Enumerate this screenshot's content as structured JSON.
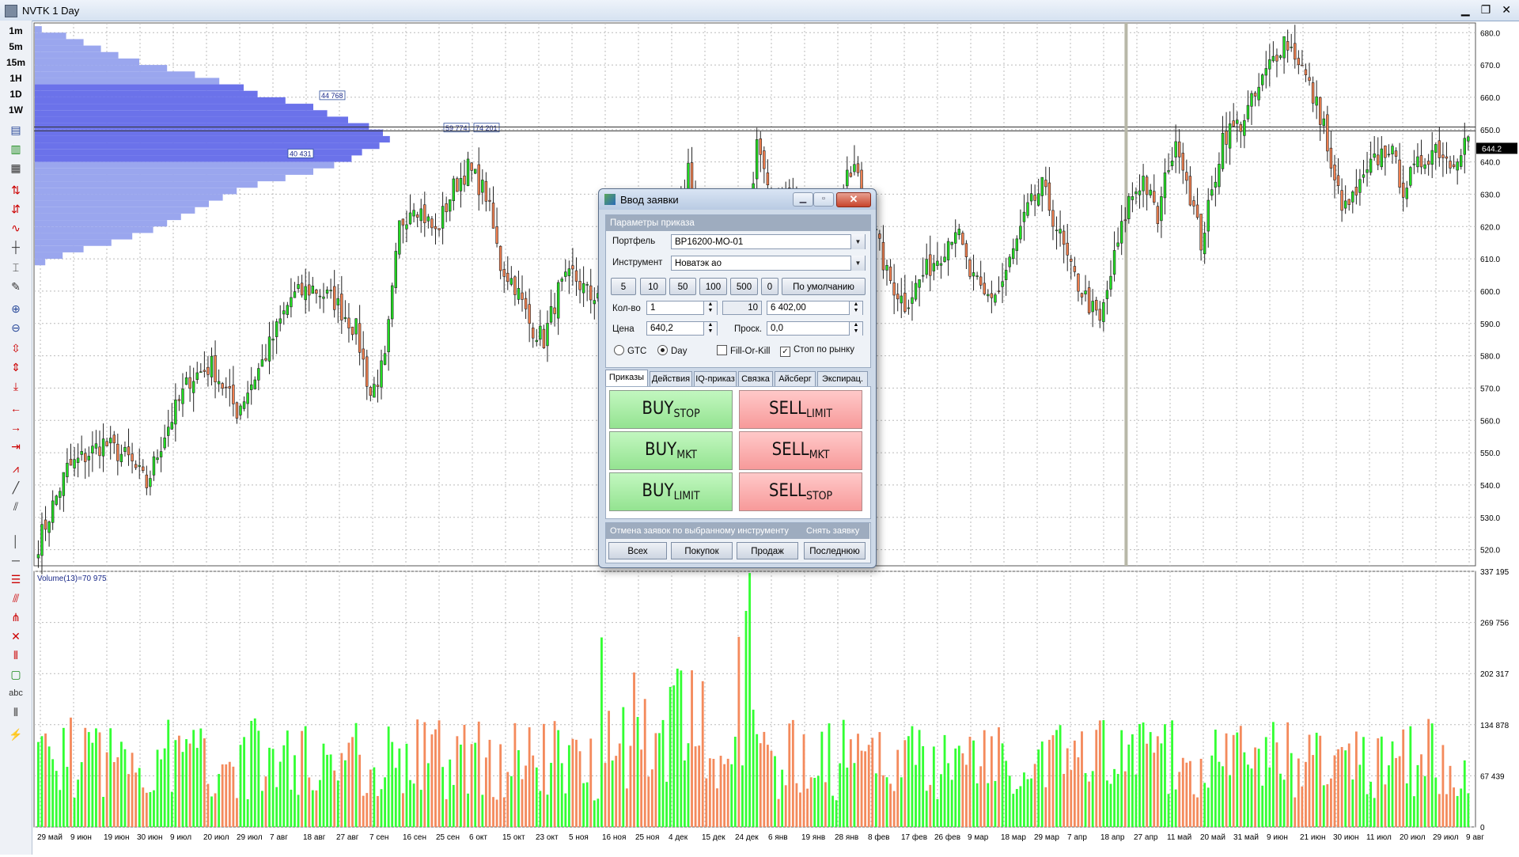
{
  "window": {
    "title": "NVTK 1 Day",
    "controls": [
      "▁",
      "❐",
      "✕"
    ]
  },
  "timeframes": [
    "1m",
    "5m",
    "15m",
    "1H",
    "1D",
    "1W"
  ],
  "toolbar_icons": [
    "line-chart-icon",
    "candle-icon",
    "bar-icon",
    "trend-up-icon",
    "trend-down-icon",
    "wave-icon",
    "crosshair-icon",
    "cursor-icon",
    "pen-icon",
    "zoom-in-icon",
    "zoom-out-icon",
    "fit-icon",
    "arrow-left-icon",
    "arrow-right-icon",
    "arrow-end-icon",
    "line-tool-icon",
    "channel-icon",
    "fib-icon",
    "text-icon",
    "rectangle-icon"
  ],
  "chart_data": [
    {
      "type": "candlestick",
      "instrument": "NVTK",
      "interval": "1 Day",
      "y_ticks": [
        "680.0",
        "670.0",
        "660.0",
        "650.0",
        "640.0",
        "630.0",
        "620.0",
        "610.0",
        "600.0",
        "590.0",
        "580.0",
        "570.0",
        "560.0",
        "550.0",
        "540.0",
        "530.0",
        "520.0"
      ],
      "ylim": [
        515,
        683
      ],
      "last_price": "644.2",
      "x_ticks": [
        "29 май",
        "9 июн",
        "19 июн",
        "30 июн",
        "9 июл",
        "20 июл",
        "29 июл",
        "7 авг",
        "18 авг",
        "27 авг",
        "7 сен",
        "16 сен",
        "25 сен",
        "6 окт",
        "15 окт",
        "23 окт",
        "5 ноя",
        "16 ноя",
        "25 ноя",
        "4 дек",
        "15 дек",
        "24 дек",
        "6 янв",
        "19 янв",
        "28 янв",
        "8 фев",
        "17 фев",
        "26 фев",
        "9 мар",
        "18 мар",
        "29 мар",
        "7 апр",
        "18 апр",
        "27 апр",
        "11 май",
        "20 май",
        "31 май",
        "9 июн",
        "21 июн",
        "30 июн",
        "11 июл",
        "20 июл",
        "29 июл",
        "9 авг"
      ],
      "profile_labels": [
        "44 768",
        "59 774",
        "74 201",
        "40 431"
      ],
      "waypoints": [
        [
          0,
          522
        ],
        [
          8,
          545
        ],
        [
          18,
          553
        ],
        [
          25,
          548
        ],
        [
          30,
          540
        ],
        [
          35,
          556
        ],
        [
          42,
          573
        ],
        [
          48,
          577
        ],
        [
          55,
          563
        ],
        [
          62,
          578
        ],
        [
          70,
          598
        ],
        [
          76,
          601
        ],
        [
          82,
          597
        ],
        [
          88,
          588
        ],
        [
          92,
          568
        ],
        [
          96,
          578
        ],
        [
          100,
          620
        ],
        [
          104,
          628
        ],
        [
          110,
          618
        ],
        [
          115,
          632
        ],
        [
          119,
          638
        ],
        [
          124,
          630
        ],
        [
          128,
          608
        ],
        [
          132,
          602
        ],
        [
          136,
          590
        ],
        [
          140,
          585
        ],
        [
          144,
          600
        ],
        [
          148,
          605
        ],
        [
          153,
          598
        ],
        [
          157,
          602
        ],
        [
          162,
          595
        ],
        [
          167,
          590
        ],
        [
          170,
          578
        ],
        [
          173,
          590
        ],
        [
          176,
          615
        ],
        [
          180,
          640
        ],
        [
          183,
          620
        ],
        [
          187,
          605
        ],
        [
          191,
          595
        ],
        [
          195,
          610
        ],
        [
          199,
          645
        ],
        [
          203,
          625
        ],
        [
          207,
          630
        ],
        [
          211,
          622
        ],
        [
          214,
          605
        ],
        [
          218,
          618
        ],
        [
          222,
          630
        ],
        [
          226,
          638
        ],
        [
          230,
          625
        ],
        [
          235,
          605
        ],
        [
          240,
          596
        ],
        [
          245,
          605
        ],
        [
          250,
          612
        ],
        [
          254,
          620
        ],
        [
          258,
          605
        ],
        [
          262,
          598
        ],
        [
          266,
          600
        ],
        [
          270,
          612
        ],
        [
          274,
          625
        ],
        [
          278,
          632
        ],
        [
          282,
          620
        ],
        [
          286,
          606
        ],
        [
          290,
          598
        ],
        [
          294,
          590
        ],
        [
          298,
          610
        ],
        [
          302,
          628
        ],
        [
          306,
          635
        ],
        [
          310,
          622
        ],
        [
          313,
          640
        ],
        [
          316,
          645
        ],
        [
          319,
          630
        ],
        [
          322,
          615
        ],
        [
          325,
          630
        ],
        [
          328,
          648
        ],
        [
          333,
          652
        ],
        [
          337,
          660
        ],
        [
          341,
          670
        ],
        [
          345,
          678
        ],
        [
          349,
          672
        ],
        [
          353,
          660
        ],
        [
          356,
          652
        ],
        [
          358,
          636
        ],
        [
          362,
          625
        ],
        [
          366,
          632
        ],
        [
          370,
          640
        ],
        [
          374,
          645
        ],
        [
          378,
          632
        ],
        [
          383,
          640
        ],
        [
          387,
          645
        ],
        [
          391,
          640
        ],
        [
          396,
          648
        ]
      ],
      "volume": {
        "label": "Volume(13)=70 975",
        "y_ticks": [
          "337 195",
          "269 756",
          "202 317",
          "134 878",
          "67 439",
          "0"
        ],
        "ylim": [
          0,
          337195
        ]
      }
    }
  ],
  "dialog": {
    "title": "Ввод заявки",
    "section_params": "Параметры приказа",
    "portfolio_label": "Портфель",
    "portfolio_value": "BP16200-MO-01",
    "instrument_label": "Инструмент",
    "instrument_value": "Новатэк ао",
    "quick_qty": [
      "5",
      "10",
      "50",
      "100",
      "500",
      "0"
    ],
    "default_button": "По умолчанию",
    "qty_label": "Кол-во",
    "qty_value": "1",
    "lot_value": "10",
    "sum_value": "6 402,00",
    "price_label": "Цена",
    "price_value": "640,2",
    "slippage_label": "Проск.",
    "slippage_value": "0,0",
    "gtc_label": "GTC",
    "day_label": "Day",
    "fok_label": "Fill-Or-Kill",
    "market_stop_label": "Стоп по рынку",
    "tabs": [
      "Приказы",
      "Действия",
      "IQ-приказ",
      "Связка",
      "Айсберг",
      "Экспирац."
    ],
    "orders": {
      "buy": "BUY",
      "sell": "SELL",
      "stop": "STOP",
      "mkt": "MKT",
      "limit": "LIMIT"
    },
    "cancel_section": "Отмена заявок по выбранному инструменту",
    "remove_section": "Снять заявку",
    "cancel_all": "Всех",
    "cancel_buys": "Покупок",
    "cancel_sells": "Продаж",
    "remove_last": "Последнюю"
  },
  "colors": {
    "up": "#22dd22",
    "down": "#f08050",
    "volume_up": "#33ff33",
    "volume_down": "#f48a5c",
    "profile_light": "#9aa6ee",
    "profile_dark": "#6b72ea"
  }
}
